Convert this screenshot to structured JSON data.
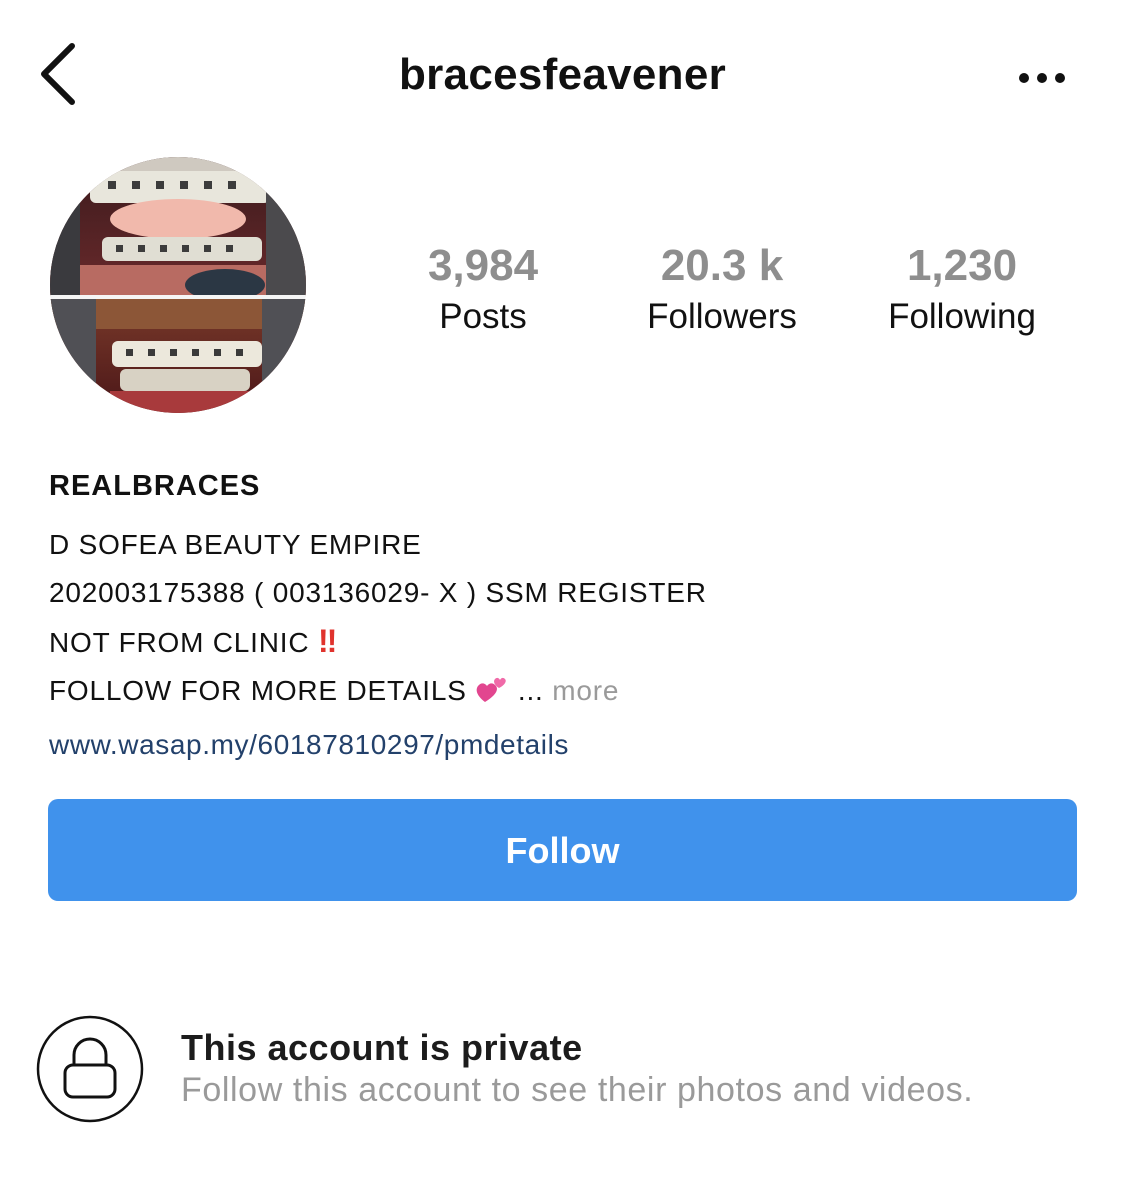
{
  "header": {
    "username": "bracesfeavener"
  },
  "stats": [
    {
      "count": "3,984",
      "label": "Posts"
    },
    {
      "count": "20.3 k",
      "label": "Followers"
    },
    {
      "count": "1,230",
      "label": "Following"
    }
  ],
  "bio": {
    "name": "REALBRACES",
    "line1": "D SOFEA BEAUTY EMPIRE",
    "line2": "202003175388 ( 003136029- X ) SSM REGISTER",
    "line3": "NOT FROM CLINIC",
    "line3_emoji": "‼",
    "line4": "FOLLOW FOR MORE DETAILS",
    "line4_ellipsis": "...",
    "more": "more",
    "link": "www.wasap.my/60187810297/pmdetails"
  },
  "actions": {
    "follow": "Follow"
  },
  "private_notice": {
    "title": "This account is private",
    "subtitle": "Follow this account to see their photos and videos."
  },
  "colors": {
    "follow_button": "#4092ec",
    "link": "#23416b",
    "muted": "#9a9a9a",
    "stat_count": "#8e8e8e"
  },
  "icons": {
    "back": "chevron-left-icon",
    "more": "ellipsis-icon",
    "lock": "lock-icon",
    "hearts": "two-hearts-icon",
    "bang": "double-exclamation-icon"
  }
}
